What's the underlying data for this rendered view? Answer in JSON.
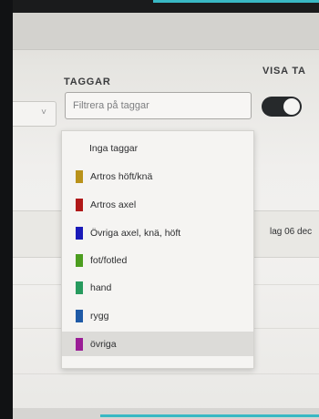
{
  "header": {
    "tags_label": "TAGGAR",
    "show_label": "VISA TA"
  },
  "filter": {
    "placeholder": "Filtrera på taggar",
    "value": ""
  },
  "toggle": {
    "state": "on",
    "color": "#26292b"
  },
  "previous_select": {
    "chevron": "chevron-down-icon",
    "glyph": "˅"
  },
  "calendar": {
    "day_label": "lag 06 dec"
  },
  "dropdown": {
    "options": [
      {
        "label": "Inga taggar",
        "color": null
      },
      {
        "label": "Artros höft/knä",
        "color": "#b9921a"
      },
      {
        "label": "Artros axel",
        "color": "#b01818"
      },
      {
        "label": "Övriga axel, knä, höft",
        "color": "#1a1ab8"
      },
      {
        "label": "fot/fotled",
        "color": "#4c9d1f"
      },
      {
        "label": "hand",
        "color": "#279a5e"
      },
      {
        "label": "rygg",
        "color": "#1f5aa6"
      },
      {
        "label": "övriga",
        "color": "#9a1d96"
      }
    ],
    "hovered_index": 7
  },
  "colors": {
    "accent": "#39b8c4"
  }
}
